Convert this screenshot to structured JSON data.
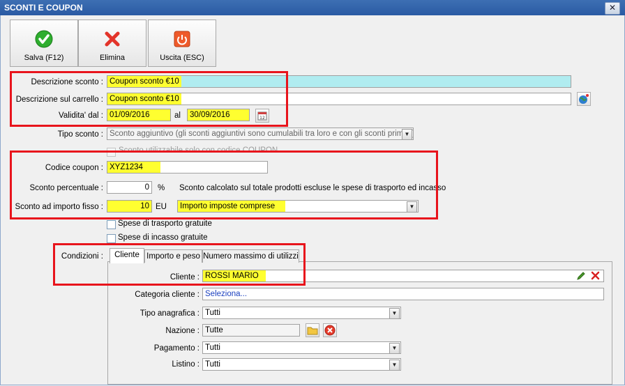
{
  "window": {
    "title": "SCONTI E COUPON",
    "close": "✕"
  },
  "toolbar": {
    "save": "Salva (F12)",
    "delete": "Elimina",
    "exit": "Uscita (ESC)"
  },
  "form": {
    "descrizione_label": "Descrizione sconto :",
    "descrizione_value": "Coupon sconto €10",
    "carrello_label": "Descrizione sul carrello :",
    "carrello_value": "Coupon sconto €10",
    "validita_label": "Validita' dal :",
    "validita_dal": "01/09/2016",
    "al_label": "al",
    "validita_al": "30/09/2016",
    "tipo_label": "Tipo sconto :",
    "tipo_value": "Sconto aggiuntivo (gli sconti aggiuntivi sono cumulabili tra loro e con gli sconti primari)",
    "coupon_checkbox_label": "Sconto utilizzabile solo con codice COUPON",
    "codice_label": "Codice coupon :",
    "codice_value": "XYZ1234",
    "percentuale_label": "Sconto percentuale :",
    "percentuale_value": "0",
    "percentuale_unit": "%",
    "percentuale_note": "Sconto calcolato sul totale prodotti escluse le spese di trasporto ed incasso",
    "fisso_label": "Sconto ad importo fisso :",
    "fisso_value": "10",
    "fisso_unit": "EU",
    "imposte_value": "Importo imposte comprese",
    "trasporto_label": "Spese di trasporto gratuite",
    "incasso_label": "Spese di incasso gratuite",
    "condizioni_label": "Condizioni :"
  },
  "tabs": [
    "Cliente",
    "Importo e peso",
    "Numero massimo di utilizzi"
  ],
  "cliente": {
    "cliente_label": "Cliente :",
    "cliente_value": "ROSSI MARIO",
    "categoria_label": "Categoria cliente :",
    "categoria_value": "Seleziona...",
    "tipo_anag_label": "Tipo anagrafica :",
    "tipo_anag_value": "Tutti",
    "nazione_label": "Nazione :",
    "nazione_value": "Tutte",
    "pagamento_label": "Pagamento :",
    "pagamento_value": "Tutti",
    "listino_label": "Listino :",
    "listino_value": "Tutti"
  },
  "colors": {
    "highlight": "#ffff30",
    "accent_red": "#e8141c",
    "cyan_field": "#b0ecf0",
    "link_blue": "#1a3fbf"
  }
}
